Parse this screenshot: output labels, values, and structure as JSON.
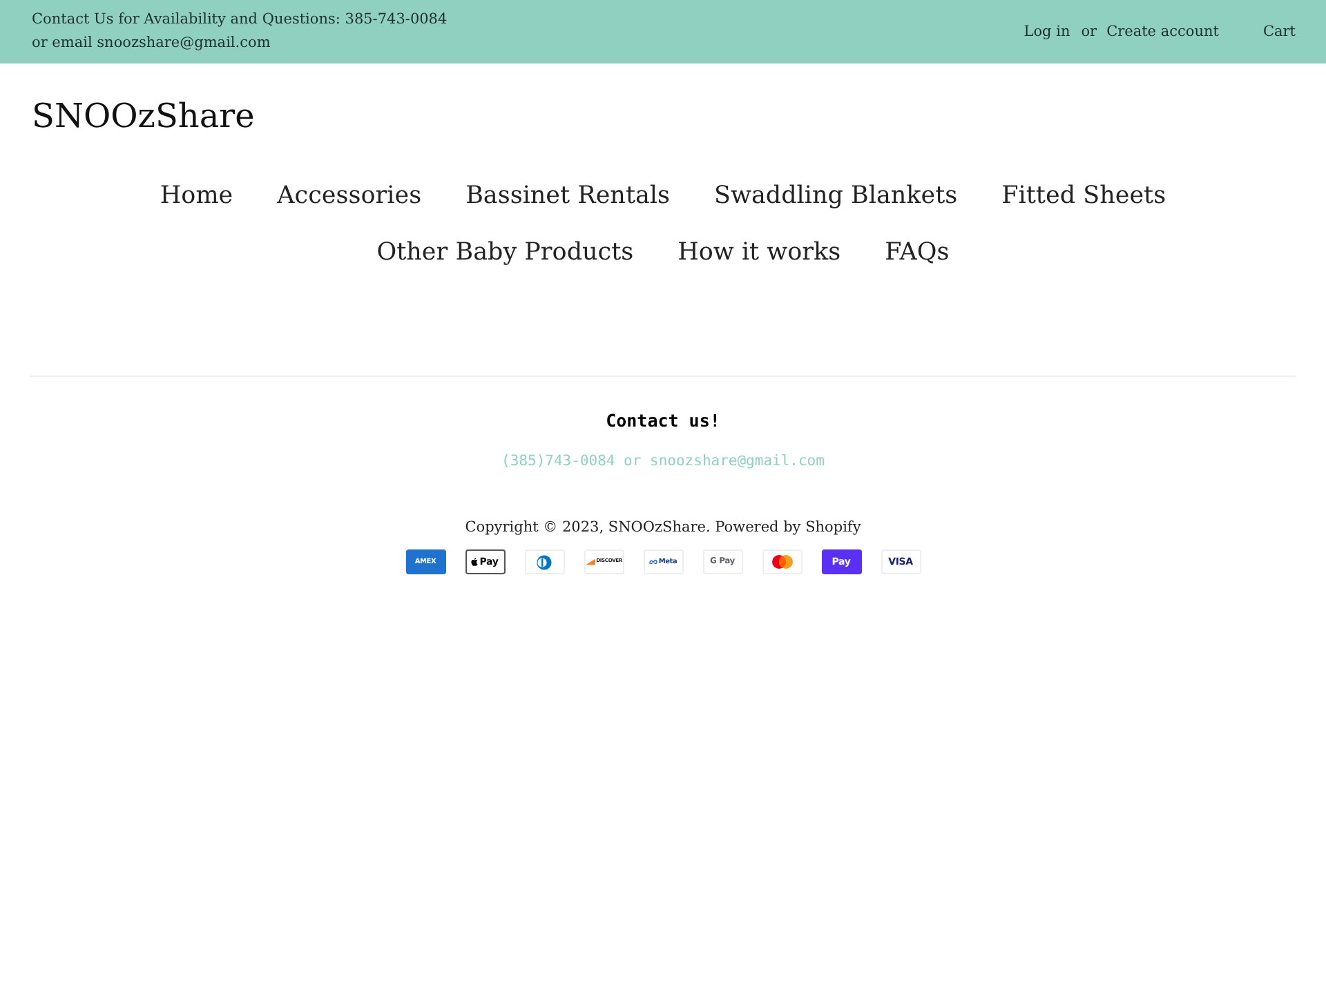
{
  "announcement": {
    "lines": [
      "Contact Us for Availability and Questions: 385-743-0084",
      "or email snoozshare@gmail.com"
    ],
    "login": "Log in",
    "separator": "or",
    "create_account": "Create account",
    "cart": "Cart"
  },
  "logo": "SNOOzShare",
  "nav": {
    "items": [
      "Home",
      "Accessories",
      "Bassinet Rentals",
      "Swaddling Blankets",
      "Fitted Sheets",
      "Other Baby Products",
      "How it works",
      "FAQs"
    ]
  },
  "footer": {
    "heading": "Contact us!",
    "contact": "(385)743-0084 or snoozshare@gmail.com",
    "copyright": "Copyright © 2023, SNOOzShare. Powered by Shopify",
    "payments": [
      {
        "kind": "amex",
        "label": "AMEX"
      },
      {
        "kind": "apple",
        "label": "Pay"
      },
      {
        "kind": "diners"
      },
      {
        "kind": "discover",
        "label": "DISCOVER"
      },
      {
        "kind": "meta",
        "label": "Meta"
      },
      {
        "kind": "google",
        "label": "G Pay"
      },
      {
        "kind": "mastercard"
      },
      {
        "kind": "shop",
        "label": "Pay"
      },
      {
        "kind": "visa",
        "label": "VISA"
      }
    ]
  }
}
